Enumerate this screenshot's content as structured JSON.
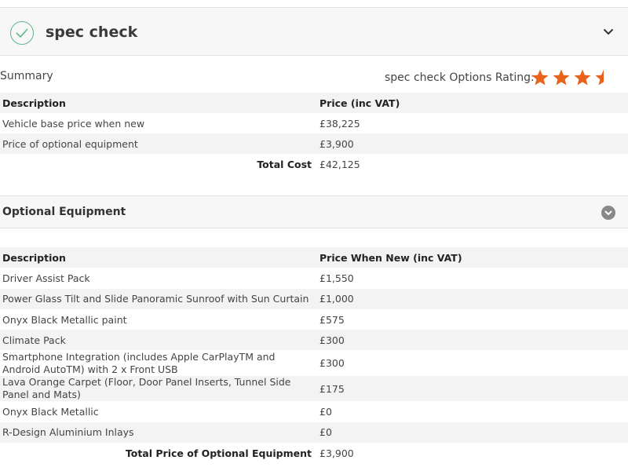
{
  "header": {
    "title": "spec check"
  },
  "summary": {
    "label": "Summary",
    "rating_label": "spec check Options Rating:",
    "rating": 3.5,
    "rating_max": 4,
    "star_color": "#e8621a",
    "columns": [
      "Description",
      "Price (inc VAT)"
    ],
    "rows": [
      [
        "Vehicle base price when new",
        "£38,225"
      ],
      [
        "Price of optional equipment",
        "£3,900"
      ]
    ],
    "total_label": "Total Cost",
    "total_value": "£42,125"
  },
  "optional": {
    "title": "Optional Equipment",
    "columns": [
      "Description",
      "Price When New (inc VAT)"
    ],
    "rows": [
      [
        "Driver Assist Pack",
        "£1,550"
      ],
      [
        "Power Glass Tilt and Slide Panoramic Sunroof with Sun Curtain",
        "£1,000"
      ],
      [
        "Onyx Black Metallic paint",
        "£575"
      ],
      [
        "Climate Pack",
        "£300"
      ],
      [
        "Smartphone Integration (includes Apple CarPlayTM and Android AutoTM) with 2 x Front USB",
        "£300"
      ],
      [
        "Lava Orange Carpet (Floor, Door Panel Inserts, Tunnel Side Panel and Mats)",
        "£175"
      ],
      [
        "Onyx Black Metallic",
        "£0"
      ],
      [
        "R-Design Aluminium Inlays",
        "£0"
      ]
    ],
    "total_label": "Total Price of Optional Equipment",
    "total_value": "£3,900"
  }
}
